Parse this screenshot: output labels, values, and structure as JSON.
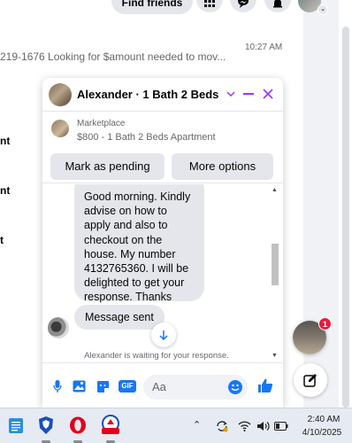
{
  "topbar": {
    "find_friends_label": "Find friends"
  },
  "background": {
    "conversation_preview": "219-1676 Looking for $amount needed to mov...",
    "conversation_time": "10:27 AM",
    "fragments": [
      "nt",
      "nt",
      "t"
    ]
  },
  "chat": {
    "title": "Alexander · 1 Bath 2 Beds ...",
    "marketplace": {
      "label": "Marketplace",
      "listing": "$800 - 1 Bath 2 Beds Apartment",
      "mark_pending_label": "Mark as pending",
      "more_options_label": "More options"
    },
    "messages": [
      {
        "sender": "other",
        "text": "Good morning. Kindly advise on how to apply and also to checkout on the house. My number 4132765360. I will be delighted to get your response. Thanks"
      },
      {
        "sender": "other",
        "text": "Message sent"
      }
    ],
    "waiting_text": "Alexander is waiting for your response.",
    "composer": {
      "placeholder": "Aa",
      "gif_label": "GIF"
    }
  },
  "floating": {
    "badge_count": "1"
  },
  "taskbar": {
    "time": "2:40 AM",
    "date": "4/10/2025",
    "apps": [
      "notepad-icon",
      "brave-icon",
      "opera-icon",
      "app-icon"
    ]
  },
  "colors": {
    "accent": "#a033ff",
    "messenger_blue": "#1877f2",
    "bubble_gray": "#e4e6eb",
    "badge_red": "#e41e3f"
  }
}
